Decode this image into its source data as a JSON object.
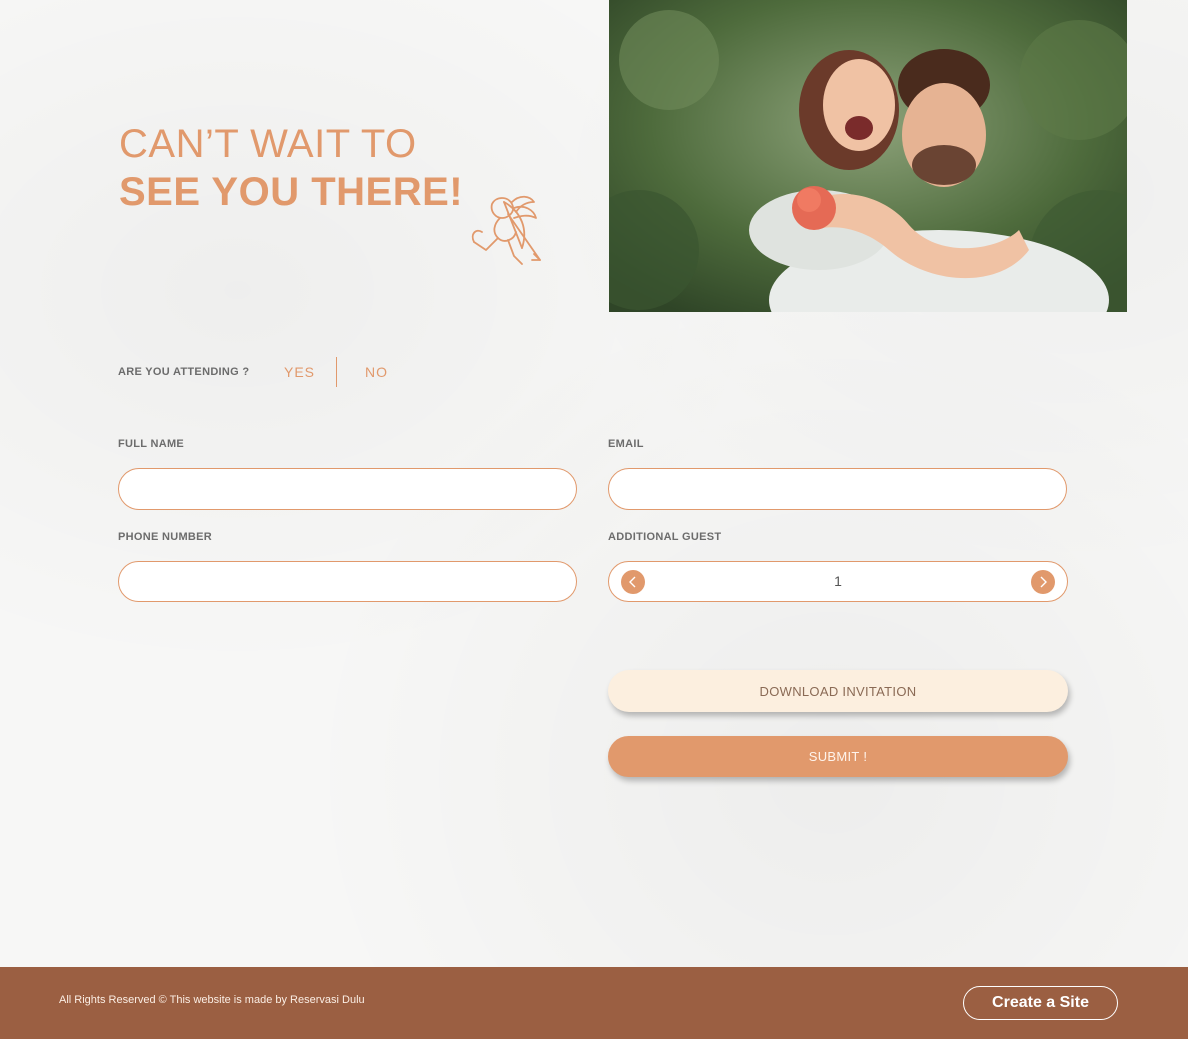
{
  "hero": {
    "headline_line1": "CAN’T WAIT TO",
    "headline_line2": "SEE YOU THERE!",
    "decoration_icon": "cupid-icon",
    "photo": "couple-photo"
  },
  "rsvp": {
    "attending_question": "ARE YOU ATTENDING ?",
    "yes_label": "YES",
    "no_label": "NO"
  },
  "form": {
    "full_name_label": "FULL NAME",
    "full_name_value": "",
    "email_label": "EMAIL",
    "email_value": "",
    "phone_label": "PHONE NUMBER",
    "phone_value": "",
    "guest_label": "ADDITIONAL GUEST",
    "guest_value": "1",
    "guest_prev_icon": "chevron-left-icon",
    "guest_next_icon": "chevron-right-icon"
  },
  "actions": {
    "download_label": "DOWNLOAD INVITATION",
    "submit_label": "SUBMIT !"
  },
  "footer": {
    "copyright": "All Rights Reserved © This website is made by Reservasi Dulu",
    "cta_label": "Create a Site"
  },
  "colors": {
    "accent": "#e1996c",
    "footer_bg": "#9b5f42",
    "download_bg": "#fcefdf"
  }
}
